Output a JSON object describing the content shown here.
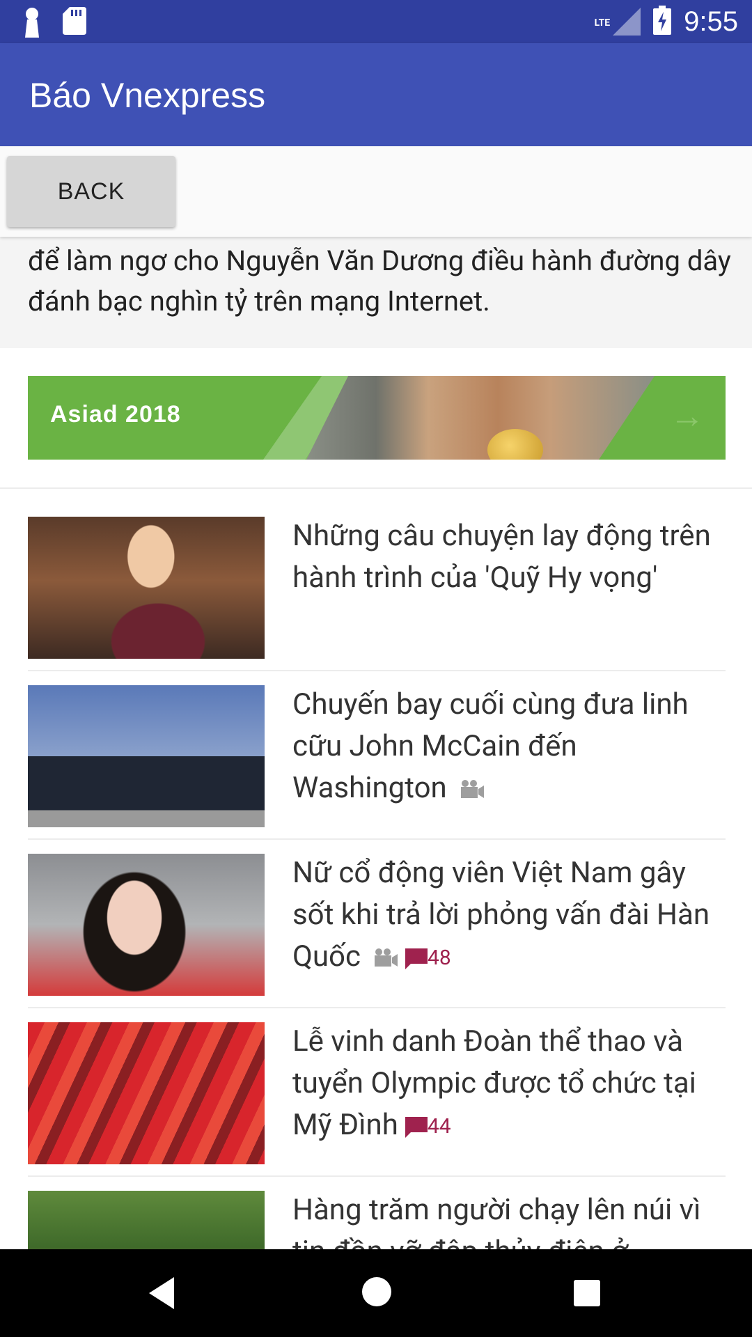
{
  "status_bar": {
    "time": "9:55",
    "network": "LTE",
    "icons": [
      "notification-icon",
      "sd-card-icon",
      "signal-icon",
      "battery-charging-icon"
    ]
  },
  "app_bar": {
    "title": "Báo Vnexpress"
  },
  "toolbar": {
    "back_label": "BACK"
  },
  "summary": {
    "text": "để làm ngơ cho Nguyễn Văn Dương điều hành đường dây đánh bạc nghìn tỷ trên mạng Internet."
  },
  "banner": {
    "label": "Asiad 2018",
    "icon": "arrow-right-icon"
  },
  "news": [
    {
      "title": "Những câu chuyện lay động trên hành trình của 'Quỹ Hy vọng'",
      "video": false,
      "comments": null
    },
    {
      "title": "Chuyến bay cuối cùng đưa linh cữu John McCain đến Washington",
      "video": true,
      "comments": null
    },
    {
      "title": "Nữ cổ động viên Việt Nam gây sốt khi trả lời phỏng vấn đài Hàn Quốc",
      "video": true,
      "comments": "48"
    },
    {
      "title": "Lễ vinh danh Đoàn thể thao và tuyển Olympic được tổ chức tại Mỹ Đình",
      "video": false,
      "comments": "44"
    },
    {
      "title": "Hàng trăm người chạy lên núi vì tin đồn vỡ đập thủy điện ở",
      "video": false,
      "comments": null
    }
  ],
  "colors": {
    "status_bar": "#303f9f",
    "app_bar": "#3f51b5",
    "banner": "#6ab344",
    "comment": "#9f224e"
  },
  "nav_bar": {
    "icons": [
      "back-triangle-icon",
      "home-circle-icon",
      "recents-square-icon"
    ]
  }
}
